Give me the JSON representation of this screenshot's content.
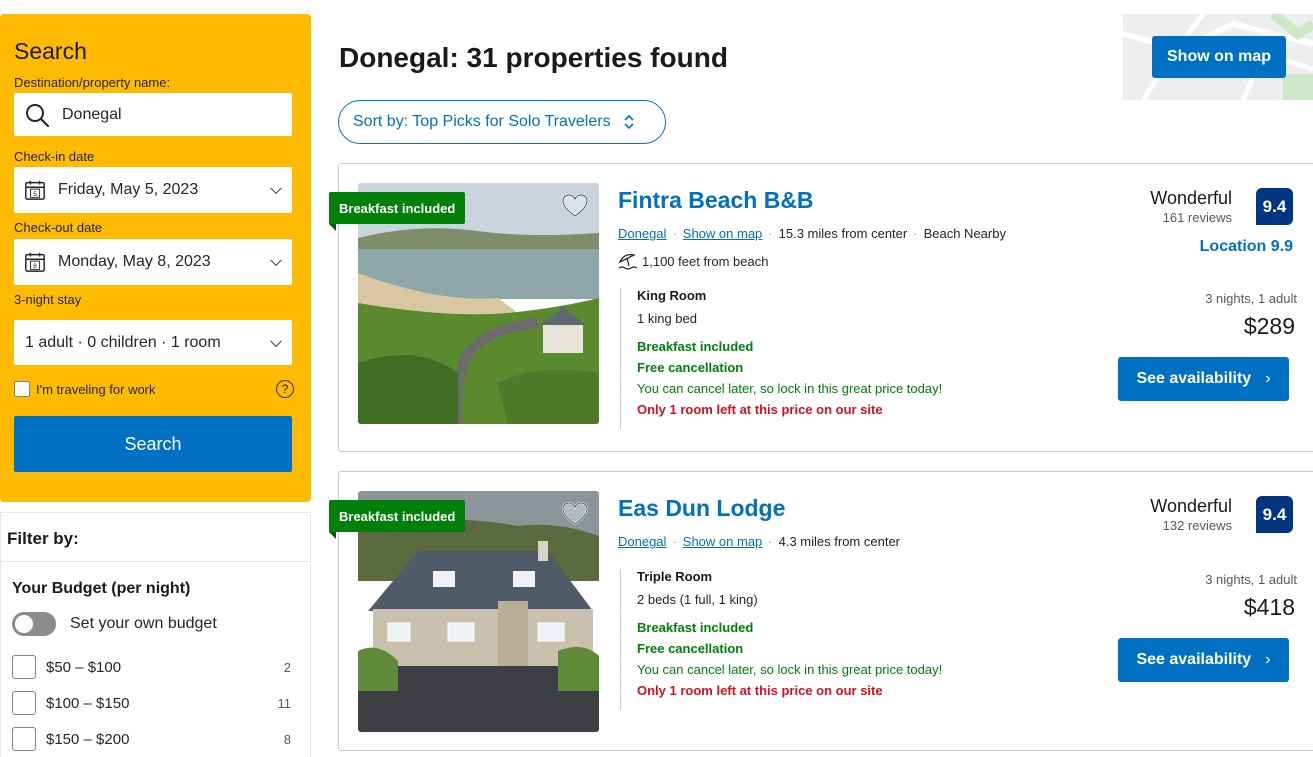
{
  "search": {
    "title": "Search",
    "destination_label": "Destination/property name:",
    "destination_value": "Donegal",
    "checkin_label": "Check-in date",
    "checkin_value": "Friday, May 5, 2023",
    "checkin_day": "5",
    "checkout_label": "Check-out date",
    "checkout_value": "Monday, May 8, 2023",
    "checkout_day": "8",
    "stay_length": "3-night stay",
    "guests_value": "1 adult · 0 children · 1 room",
    "work_label": "I'm traveling for work",
    "help_glyph": "?",
    "search_button": "Search"
  },
  "filters": {
    "title": "Filter by:",
    "budget_title": "Your Budget (per night)",
    "own_budget_label": "Set your own budget",
    "budget_options": [
      {
        "label": "$50 – $100",
        "count": "2"
      },
      {
        "label": "$100 – $150",
        "count": "11"
      },
      {
        "label": "$150 – $200",
        "count": "8"
      }
    ]
  },
  "header": {
    "results_title": "Donegal: 31 properties found",
    "sort_label": "Sort by: Top Picks for Solo Travelers",
    "map_button": "Show on map"
  },
  "properties": [
    {
      "badge": "Breakfast included",
      "name": "Fintra Beach B&B",
      "location_link": "Donegal",
      "map_link": "Show on map",
      "distance": "15.3 miles from center",
      "extra": "Beach Nearby",
      "beach_distance": "1,100 feet from beach",
      "rating_word": "Wonderful",
      "reviews": "161 reviews",
      "score": "9.4",
      "location_score": "Location 9.9",
      "room_type": "King Room",
      "beds": "1 king bed",
      "breakfast": "Breakfast included",
      "cancellation": "Free cancellation",
      "cancel_note": "You can cancel later, so lock in this great price today!",
      "scarcity": "Only 1 room left at this price on our site",
      "stay_summary": "3 nights, 1 adult",
      "price": "$289",
      "cta": "See availability"
    },
    {
      "badge": "Breakfast included",
      "name": "Eas Dun Lodge",
      "location_link": "Donegal",
      "map_link": "Show on map",
      "distance": "4.3 miles from center",
      "rating_word": "Wonderful",
      "reviews": "132 reviews",
      "score": "9.4",
      "room_type": "Triple Room",
      "beds": "2 beds (1 full, 1 king)",
      "breakfast": "Breakfast included",
      "cancellation": "Free cancellation",
      "cancel_note": "You can cancel later, so lock in this great price today!",
      "scarcity": "Only 1 room left at this price on our site",
      "stay_summary": "3 nights, 1 adult",
      "price": "$418",
      "cta": "See availability"
    }
  ],
  "colors": {
    "brand_yellow": "#febb02",
    "primary_blue": "#0071c2",
    "dark_blue": "#003580",
    "green": "#008009",
    "red": "#d4111e"
  }
}
